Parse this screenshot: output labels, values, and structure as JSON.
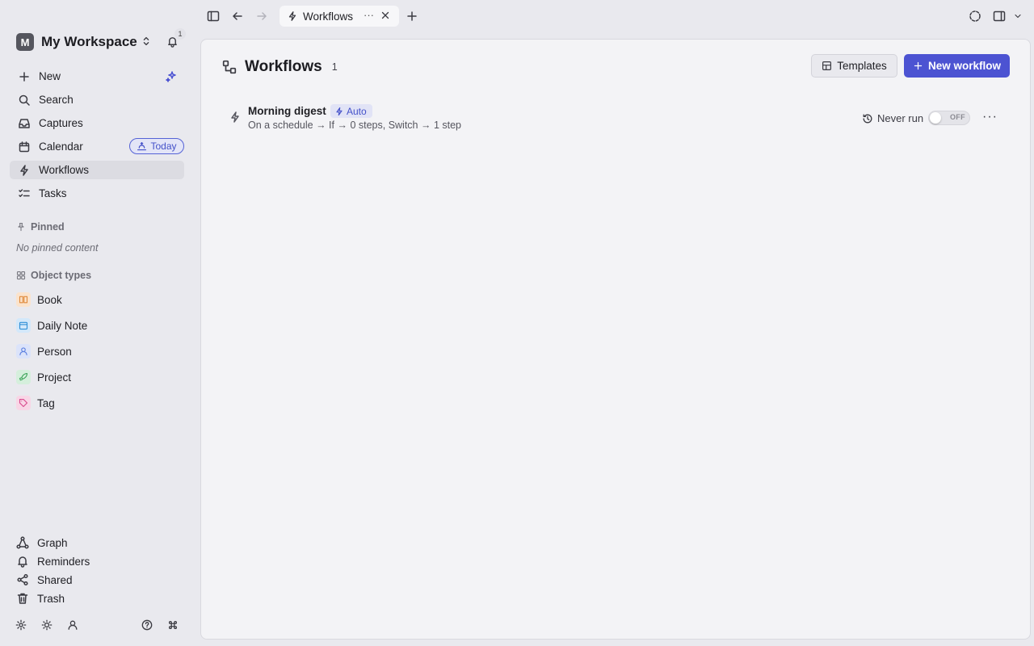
{
  "workspace": {
    "initial": "M",
    "name": "My Workspace",
    "notification_count": "1"
  },
  "sidebar": {
    "nav": [
      {
        "label": "New",
        "icon": "plus-icon"
      },
      {
        "label": "Search",
        "icon": "search-icon"
      },
      {
        "label": "Captures",
        "icon": "inbox-icon"
      },
      {
        "label": "Calendar",
        "icon": "calendar-icon",
        "pill": "Today"
      },
      {
        "label": "Workflows",
        "icon": "bolt-icon",
        "active": true
      },
      {
        "label": "Tasks",
        "icon": "checklist-icon"
      }
    ],
    "pinned": {
      "title": "Pinned",
      "empty": "No pinned content"
    },
    "object_types": {
      "title": "Object types",
      "items": [
        {
          "label": "Book",
          "color": "#f2a05a"
        },
        {
          "label": "Daily Note",
          "color": "#3b9be0"
        },
        {
          "label": "Person",
          "color": "#6b8fe6"
        },
        {
          "label": "Project",
          "color": "#4db36a"
        },
        {
          "label": "Tag",
          "color": "#e0589a"
        }
      ]
    },
    "bottom": [
      {
        "label": "Graph",
        "icon": "graph-icon"
      },
      {
        "label": "Reminders",
        "icon": "bell-icon"
      },
      {
        "label": "Shared",
        "icon": "share-icon"
      },
      {
        "label": "Trash",
        "icon": "trash-icon"
      }
    ]
  },
  "tabs": [
    {
      "label": "Workflows",
      "icon": "bolt-icon"
    }
  ],
  "main": {
    "title": "Workflows",
    "count": "1",
    "templates_label": "Templates",
    "new_label": "New workflow",
    "accent": "#4c53d2",
    "workflows": [
      {
        "name": "Morning digest",
        "badge": "Auto",
        "description": "On a schedule → If → 0 steps, Switch → 1 step",
        "last_run": "Never run",
        "toggle": "OFF"
      }
    ]
  }
}
